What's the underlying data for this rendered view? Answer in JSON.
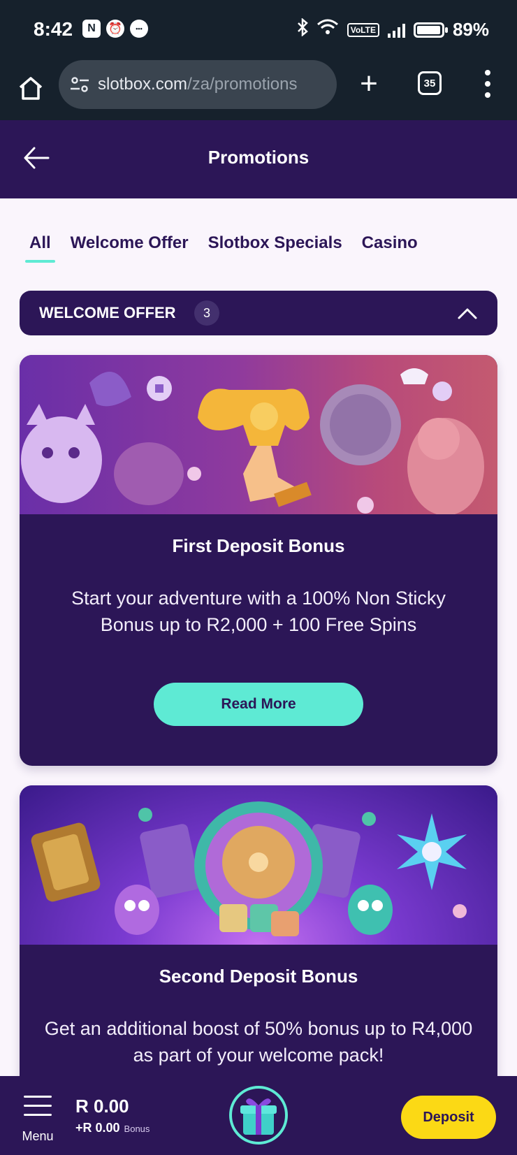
{
  "status": {
    "time": "8:42",
    "battery": "89%",
    "volte": "VoLTE",
    "left_icons": [
      "N",
      "⏰",
      "•••"
    ]
  },
  "browser": {
    "url_host": "slotbox.com",
    "url_path": "/za/promotions",
    "tab_count": "35"
  },
  "header": {
    "title": "Promotions"
  },
  "filters": [
    {
      "label": "All",
      "active": true
    },
    {
      "label": "Welcome Offer",
      "active": false
    },
    {
      "label": "Slotbox Specials",
      "active": false
    },
    {
      "label": "Casino",
      "active": false
    }
  ],
  "section": {
    "title": "WELCOME OFFER",
    "count": "3"
  },
  "cards": [
    {
      "title": "First Deposit Bonus",
      "description": "Start your adventure with a 100% Non Sticky Bonus up to R2,000 + 100 Free Spins",
      "button": "Read More"
    },
    {
      "title": "Second Deposit Bonus",
      "description": "Get an additional boost of 50% bonus up to R4,000 as part of your welcome pack!"
    }
  ],
  "bottom": {
    "menu_label": "Menu",
    "balance": "R 0.00",
    "bonus_amount": "+R 0.00",
    "bonus_label": "Bonus",
    "deposit_label": "Deposit"
  },
  "colors": {
    "brand_purple": "#2c1657",
    "accent_teal": "#5eead4",
    "deposit_yellow": "#fbd915"
  }
}
